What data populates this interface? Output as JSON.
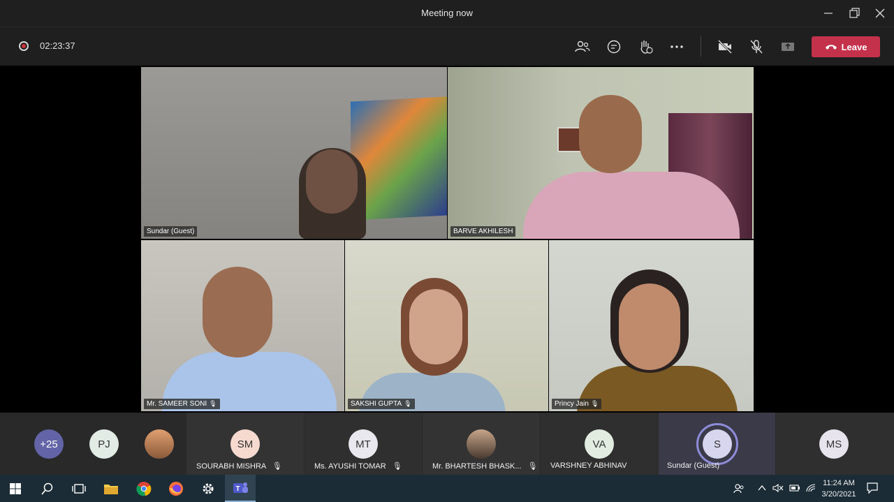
{
  "window": {
    "title": "Meeting now"
  },
  "toolbar": {
    "timer": "02:23:37",
    "leave_label": "Leave"
  },
  "tiles": [
    {
      "name": "Sundar (Guest)",
      "muted": false
    },
    {
      "name": "BARVE AKHILESH",
      "muted": false
    },
    {
      "name": "Mr. SAMEER SONI",
      "muted": true
    },
    {
      "name": "SAKSHI GUPTA",
      "muted": true
    },
    {
      "name": "Princy Jain",
      "muted": true
    }
  ],
  "strip": {
    "overflow": "+25",
    "pj_initials": "PJ",
    "participants": [
      {
        "initials": "SM",
        "name": "SOURABH MISHRA",
        "muted": true
      },
      {
        "initials": "MT",
        "name": "Ms. AYUSHI TOMAR",
        "muted": true
      },
      {
        "initials": "",
        "name": "Mr. BHARTESH BHASK...",
        "muted": true
      },
      {
        "initials": "VA",
        "name": "VARSHNEY ABHINAV",
        "muted": false
      },
      {
        "initials": "S",
        "name": "Sundar (Guest)",
        "muted": false
      },
      {
        "initials": "MS",
        "name": "",
        "muted": false
      }
    ]
  },
  "taskbar": {
    "time": "11:24 AM",
    "date": "3/20/2021"
  },
  "colors": {
    "leave": "#c4314b",
    "overflow_avatar": "#6264a7",
    "active_ring": "#8e8cd8"
  }
}
